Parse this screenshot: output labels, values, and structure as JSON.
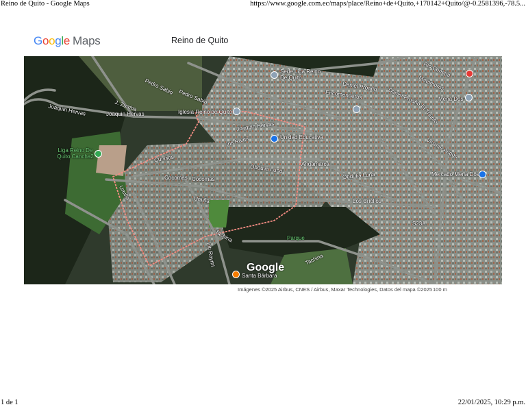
{
  "print_header": {
    "title": "Reino de Quito - Google Maps",
    "url": "https://www.google.com.ec/maps/place/Reino+de+Quito,+170142+Quito/@-0.2581396,-78.5..."
  },
  "logo": {
    "text": "Google Maps"
  },
  "place_title": "Reino de Quito",
  "map": {
    "streets": [
      "Joaquin Hervas",
      "Joaquin Hervas",
      "J. Zumba",
      "Pedro Sabio",
      "Pedro Sabio",
      "Encomenderos",
      "Daniel Proaño",
      "Daniel Proaño",
      "Rio Cenepa",
      "Matamoros",
      "El Triunfo",
      "Vicente Angos",
      "Joaquin Hervas",
      "Inti Raimi",
      "Cunisos",
      "Cocomas",
      "Cocomas",
      "Obdulia Luna",
      "Obdulia Luna",
      "Angamarca",
      "Umiña",
      "Umiña",
      "Los Criollos",
      "Tachina",
      "Tachina",
      "Inti Raymi",
      "S23A",
      "Parque"
    ],
    "places": [
      "Sede Liga Reino De Quito",
      "Iglesia Reino de Quito",
      "Liga Reino De Quito Cancha2",
      "Mercado Mena Dos",
      "Santa Bárbara",
      "Unidad Educativa",
      "Mena Dos"
    ],
    "watermark": "Google",
    "boundary_color": "#f28b82"
  },
  "attribution": "Imágenes ©2025 Airbus, CNES / Airbus, Maxar Technologies, Datos del mapa ©2025",
  "scale": "100 m",
  "print_footer": {
    "page": "1 de 1",
    "datetime": "22/01/2025, 10:29 p.m."
  }
}
